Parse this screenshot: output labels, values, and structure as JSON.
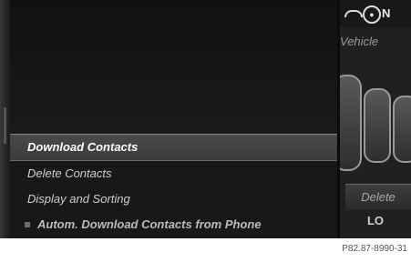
{
  "menu": {
    "items": [
      {
        "label": "Download Contacts",
        "selected": true
      },
      {
        "label": "Delete Contacts",
        "selected": false
      },
      {
        "label": "Display and Sorting",
        "selected": false
      },
      {
        "label": "Autom. Download Contacts from Phone",
        "selected": false,
        "checkbox": true
      }
    ]
  },
  "status_bar": {
    "network_label": "N",
    "icons": [
      "phone-icon",
      "network-icon"
    ]
  },
  "side_panel": {
    "vehicle_label": "Vehicle",
    "delete_label": "Delete",
    "lo_label": "LO"
  },
  "figure_code": "P82.87-8990-31"
}
